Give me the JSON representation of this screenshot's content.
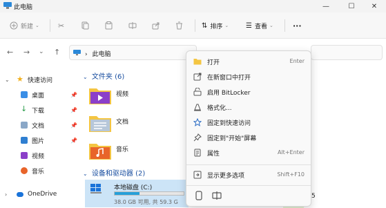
{
  "window": {
    "title": "此电脑"
  },
  "toolbar": {
    "new_label": "新建",
    "sort_label": "排序",
    "view_label": "查看",
    "more_label": "···"
  },
  "address": {
    "path_sep": "›",
    "path": "此电脑"
  },
  "sidebar": {
    "items": [
      {
        "label": "快速访问",
        "icon": "star-icon"
      },
      {
        "label": "桌面",
        "icon": "desktop-icon"
      },
      {
        "label": "下载",
        "icon": "download-icon"
      },
      {
        "label": "文档",
        "icon": "document-icon"
      },
      {
        "label": "图片",
        "icon": "picture-icon"
      },
      {
        "label": "视频",
        "icon": "video-icon"
      },
      {
        "label": "音乐",
        "icon": "music-icon"
      },
      {
        "label": "OneDrive",
        "icon": "cloud-icon"
      }
    ]
  },
  "content": {
    "folders_header": "文件夹 (6)",
    "folders": [
      {
        "label": "视频"
      },
      {
        "label": "文档"
      },
      {
        "label": "音乐"
      }
    ],
    "drives_header": "设备和驱动器 (2)",
    "drive": {
      "label": "本地磁盘 (C:)",
      "free_text": "38.0 GB 可用, 共 59.3 G",
      "used_fraction": 0.36
    },
    "peek_text": "/5"
  },
  "context_menu": {
    "items": [
      {
        "label": "打开",
        "shortcut": "Enter",
        "icon": "open-folder-icon"
      },
      {
        "label": "在新窗口中打开",
        "shortcut": "",
        "icon": "new-window-icon"
      },
      {
        "label": "启用 BitLocker",
        "shortcut": "",
        "icon": "bitlocker-icon"
      },
      {
        "label": "格式化...",
        "shortcut": "",
        "icon": "format-icon"
      },
      {
        "label": "固定到快速访问",
        "shortcut": "",
        "icon": "star-icon"
      },
      {
        "label": "固定到\"开始\"屏幕",
        "shortcut": "",
        "icon": "pin-icon"
      },
      {
        "label": "属性",
        "shortcut": "Alt+Enter",
        "icon": "properties-icon"
      },
      {
        "label": "显示更多选项",
        "shortcut": "Shift+F10",
        "icon": "more-options-icon"
      }
    ]
  },
  "colors": {
    "accent": "#26a0da",
    "selection": "#cce4f7",
    "folder_yellow": "#f4c542"
  }
}
